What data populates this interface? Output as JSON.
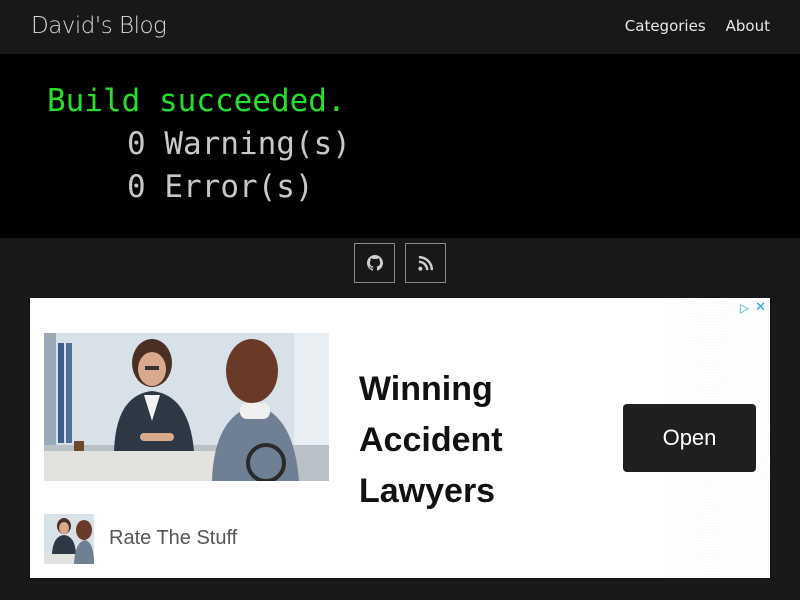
{
  "navbar": {
    "brand": "David's Blog",
    "links": [
      {
        "label": "Categories"
      },
      {
        "label": "About"
      }
    ]
  },
  "terminal": {
    "line1": "Build succeeded.",
    "line2": "0 Warning(s)",
    "line3": "0 Error(s)",
    "success_color": "#25e02a"
  },
  "social": {
    "icons": [
      "github-icon",
      "rss-icon"
    ]
  },
  "ad": {
    "headline_lines": [
      "Winning",
      "Accident",
      "Lawyers"
    ],
    "button_label": "Open",
    "advertiser": "Rate The Stuff",
    "choices_color": "#17a3d9"
  }
}
